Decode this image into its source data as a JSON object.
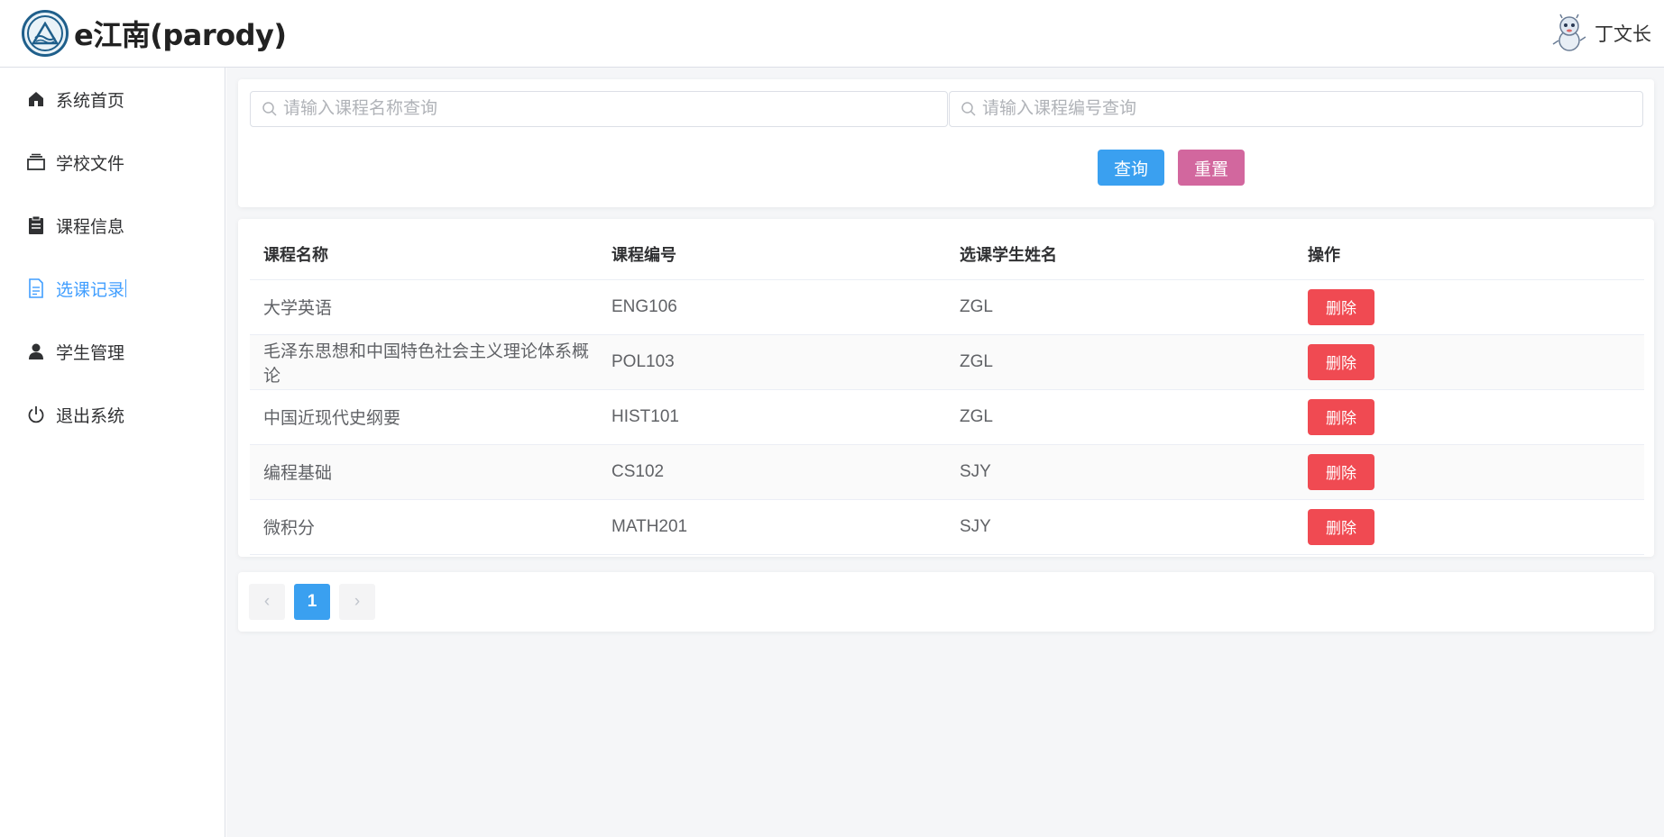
{
  "header": {
    "title": "e江南(parody)",
    "username": "丁文长"
  },
  "sidebar": {
    "items": [
      {
        "label": "系统首页",
        "icon": "home-icon"
      },
      {
        "label": "学校文件",
        "icon": "folder-icon"
      },
      {
        "label": "课程信息",
        "icon": "clipboard-icon"
      },
      {
        "label": "选课记录",
        "icon": "document-icon",
        "active": true
      },
      {
        "label": "学生管理",
        "icon": "user-icon"
      },
      {
        "label": "退出系统",
        "icon": "power-icon"
      }
    ]
  },
  "search": {
    "name_placeholder": "请输入课程名称查询",
    "code_placeholder": "请输入课程编号查询",
    "query_label": "查询",
    "reset_label": "重置"
  },
  "table": {
    "headers": [
      "课程名称",
      "课程编号",
      "选课学生姓名",
      "操作"
    ],
    "rows": [
      {
        "name": "大学英语",
        "code": "ENG106",
        "student": "ZGL"
      },
      {
        "name": "毛泽东思想和中国特色社会主义理论体系概论",
        "code": "POL103",
        "student": "ZGL"
      },
      {
        "name": "中国近现代史纲要",
        "code": "HIST101",
        "student": "ZGL"
      },
      {
        "name": "编程基础",
        "code": "CS102",
        "student": "SJY"
      },
      {
        "name": "微积分",
        "code": "MATH201",
        "student": "SJY"
      }
    ],
    "delete_label": "删除"
  },
  "pagination": {
    "prev": "‹",
    "current": "1",
    "next": "›"
  },
  "colors": {
    "accent": "#409eff",
    "query_button": "#3aa0f0",
    "reset_button": "#d2679e",
    "delete_button": "#f04a52"
  }
}
